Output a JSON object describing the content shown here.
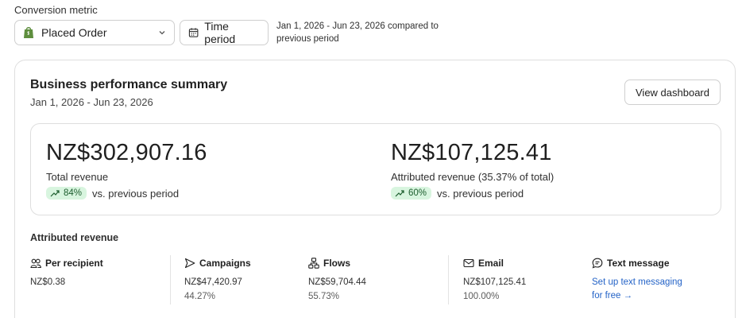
{
  "filters": {
    "label": "Conversion metric",
    "metric_select": "Placed Order",
    "time_period_button": "Time period",
    "period_note": "Jan 1, 2026 - Jun 23, 2026 compared to previous period"
  },
  "card": {
    "title": "Business performance summary",
    "date_range": "Jan 1, 2026 - Jun 23, 2026",
    "view_dashboard_button": "View dashboard"
  },
  "summary": {
    "total": {
      "value": "NZ$302,907.16",
      "caption": "Total revenue",
      "change": "84%",
      "change_text": "vs. previous period"
    },
    "attributed": {
      "value": "NZ$107,125.41",
      "caption": "Attributed revenue (35.37% of total)",
      "change": "60%",
      "change_text": "vs. previous period"
    }
  },
  "attributed_revenue": {
    "title": "Attributed revenue",
    "columns": [
      {
        "label": "Per recipient",
        "icon": "recipients-icon",
        "value": "NZ$0.38"
      },
      {
        "label": "Campaigns",
        "icon": "campaign-icon",
        "value": "NZ$47,420.97",
        "percent": "44.27%"
      },
      {
        "label": "Flows",
        "icon": "flows-icon",
        "value": "NZ$59,704.44",
        "percent": "55.73%"
      },
      {
        "label": "Email",
        "icon": "email-icon",
        "value": "NZ$107,125.41",
        "percent": "100.00%"
      },
      {
        "label": "Text message",
        "icon": "text-message-icon",
        "link_line1": "Set up text messaging",
        "link_line2": "for free →"
      }
    ]
  },
  "colors": {
    "badge_bg": "#d8f5df",
    "badge_text": "#1d5e2e",
    "link": "#2463c7",
    "shopify_green": "#5e8e3e"
  }
}
